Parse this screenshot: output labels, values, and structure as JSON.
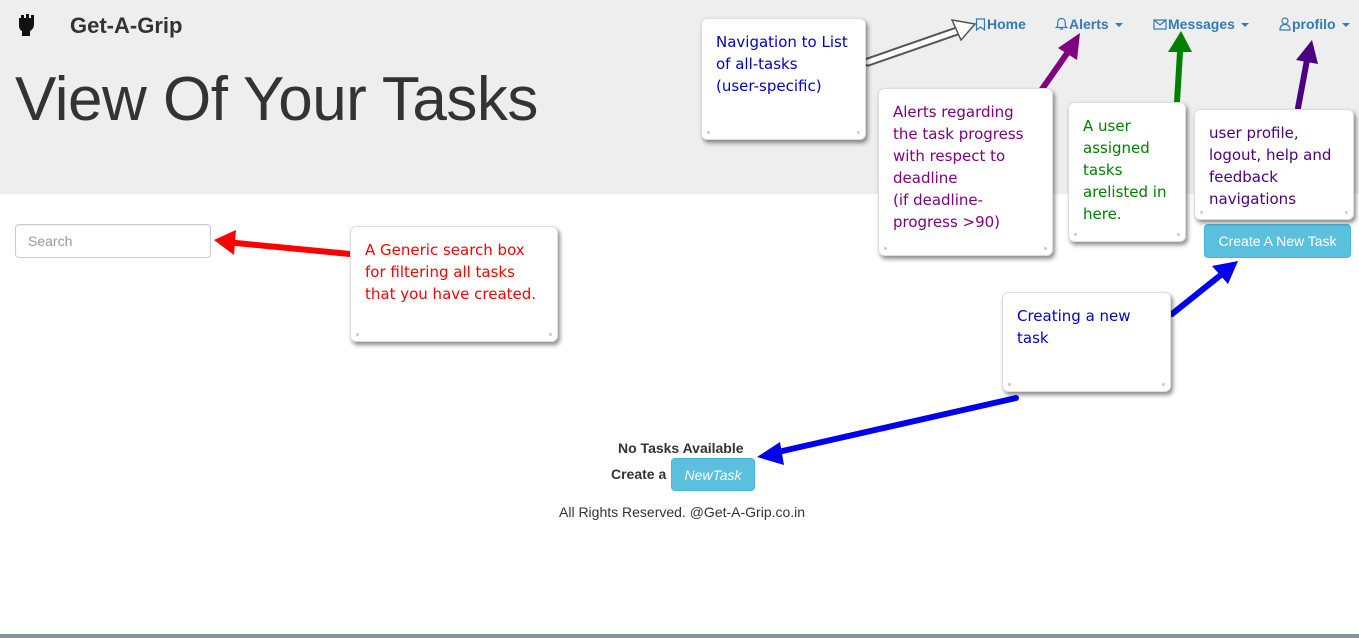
{
  "brand": {
    "name": "Get-A-Grip",
    "logo_icon": "raised-fist-icon"
  },
  "header": {
    "title": "View Of Your Tasks"
  },
  "nav": {
    "home": {
      "label": "Home",
      "icon": "bookmark-icon"
    },
    "alerts": {
      "label": "Alerts",
      "icon": "bell-icon"
    },
    "messages": {
      "label": "Messages",
      "icon": "envelope-icon"
    },
    "profile": {
      "label": "profilo",
      "icon": "user-icon"
    }
  },
  "search": {
    "placeholder": "Search",
    "value": ""
  },
  "create_button": {
    "label": "Create A New Task"
  },
  "empty_state": {
    "message": "No Tasks Available",
    "prompt": "Create a",
    "button_label": "NewTask"
  },
  "footer": {
    "text": "All Rights Reserved. @Get-A-Grip.co.in"
  },
  "annotations": {
    "home": {
      "text": "Navigation to List\nof all-tasks\n(user-specific)",
      "color": "#0000cc"
    },
    "alerts": {
      "text": "Alerts regarding\nthe task progress\nwith respect to\ndeadline\n(if deadline-\nprogress >90)",
      "color": "#800080"
    },
    "messages": {
      "text": "A user\nassigned\ntasks\narelisted in\nhere.",
      "color": "#008000"
    },
    "profile": {
      "text": "user profile,\nlogout, help and\nfeedback\nnavigations",
      "color": "#4b0082"
    },
    "search": {
      "text": "A Generic search box\nfor filtering all tasks\nthat you have created.",
      "color": "#ff0000"
    },
    "create": {
      "text": "Creating a new\ntask",
      "color": "#0000cc"
    }
  },
  "colors": {
    "jumbotron_bg": "#eeeeee",
    "link": "#337ab7",
    "info_button": "#5bc0de"
  }
}
